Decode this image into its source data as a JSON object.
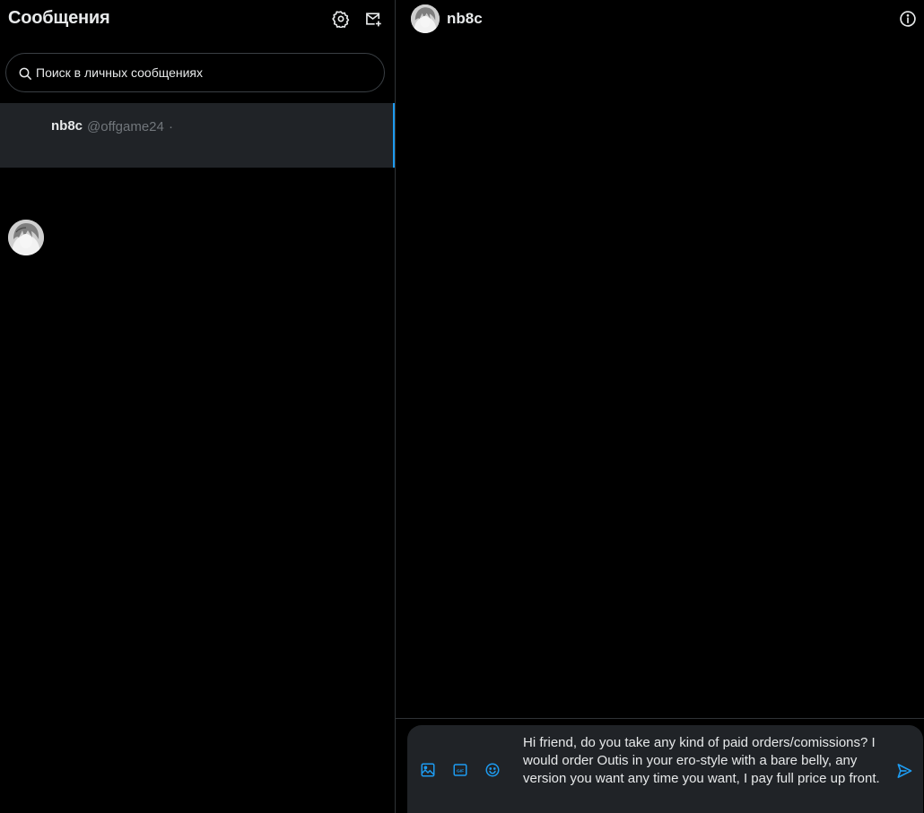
{
  "sidebar": {
    "title": "Сообщения",
    "settings_icon": "gear-icon",
    "new_message_icon": "new-message-icon",
    "search": {
      "placeholder": "Поиск в личных сообщениях",
      "icon": "search-icon"
    },
    "conversations": [
      {
        "name": "nb8c",
        "handle": "@offgame24",
        "separator": "·",
        "selected": true
      }
    ]
  },
  "chat": {
    "name": "nb8c",
    "info_icon": "info-icon",
    "composer": {
      "media_icon": "image-icon",
      "gif_icon": "gif-icon",
      "emoji_icon": "emoji-icon",
      "send_icon": "send-icon",
      "text": "Hi friend, do you take any kind of paid orders/comissions? I would order Outis in your ero-style with a bare belly, any version you want any time you want, I pay full price up front."
    }
  },
  "colors": {
    "background": "#000000",
    "selected_row": "#202327",
    "accent": "#1d9bf0",
    "text_primary": "#e7e9ea",
    "text_secondary": "#71767b",
    "border": "#2f3336"
  }
}
